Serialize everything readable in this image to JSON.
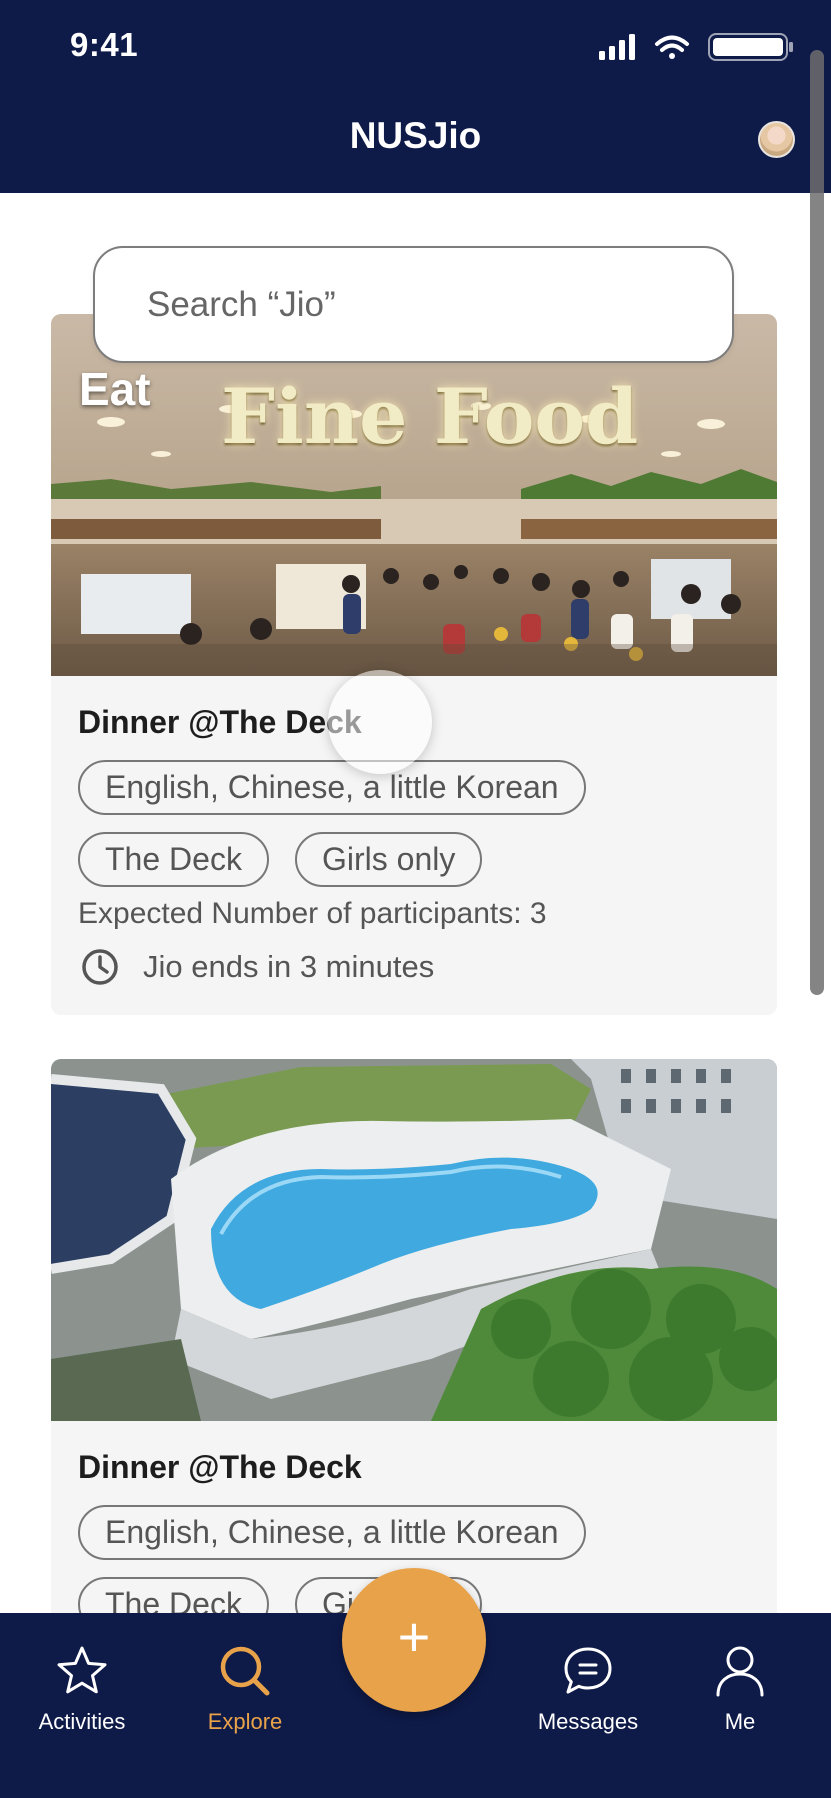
{
  "status_bar": {
    "time": "9:41"
  },
  "header": {
    "title": "NUSJio"
  },
  "search": {
    "placeholder": "Search “Jio”"
  },
  "cards": [
    {
      "category": "Eat",
      "banner": "Fine Food",
      "title": "Dinner @The Deck",
      "tags": [
        "English, Chinese, a little Korean",
        "The Deck",
        "Girls only"
      ],
      "participants": "Expected Number of participants: 3",
      "deadline": "Jio ends in 3 minutes"
    },
    {
      "title": "Dinner @The Deck",
      "tags": [
        "English, Chinese, a little Korean",
        "The Deck",
        "Girls only"
      ]
    }
  ],
  "tabbar": {
    "items": [
      {
        "label": "Activities",
        "icon": "star-icon",
        "active": false
      },
      {
        "label": "Explore",
        "icon": "search-icon",
        "active": true
      },
      {
        "label": "Messages",
        "icon": "chat-bubble-icon",
        "active": false
      },
      {
        "label": "Me",
        "icon": "person-icon",
        "active": false
      }
    ],
    "fab": {
      "label": "+",
      "icon": "plus-icon"
    }
  },
  "colors": {
    "navy": "#0e1a48",
    "accent": "#e8a24a",
    "card_bg": "#f5f5f5",
    "chip_border": "#777777"
  }
}
